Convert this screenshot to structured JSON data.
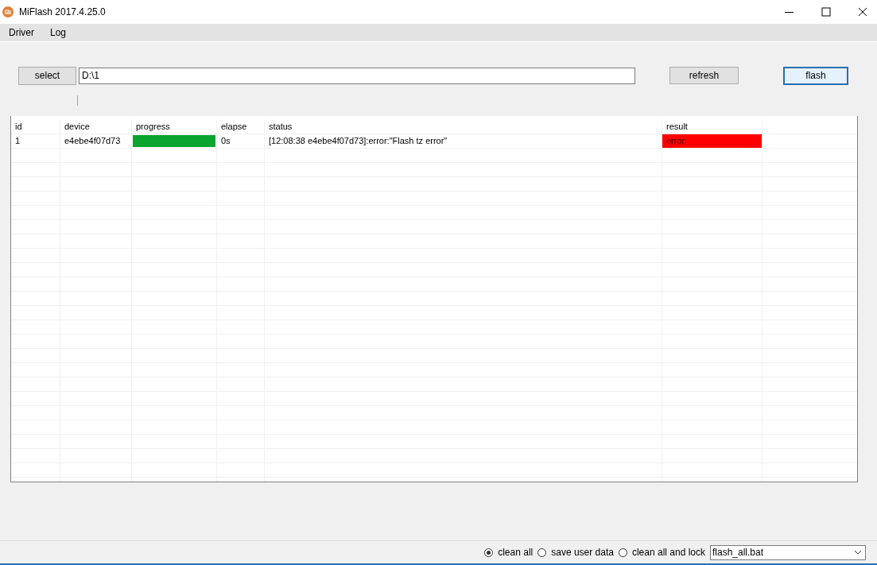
{
  "window": {
    "title": "MiFlash 2017.4.25.0"
  },
  "menu": [
    "Driver",
    "Log"
  ],
  "select_button": "select",
  "path_field": {
    "value": "D:\\1"
  },
  "refresh_button": "refresh",
  "flash_button": {
    "label": "flash",
    "focused": true
  },
  "table": {
    "columns": [
      "id",
      "device",
      "progress",
      "elapse",
      "status",
      "result"
    ],
    "rows": [
      {
        "id": "1",
        "device": "e4ebe4f07d73",
        "progress": {
          "level": 1.0
        },
        "elapse": "0s",
        "status": "[12:08:38  e4ebe4f07d73]:error:\"Flash tz error\"",
        "result": "error",
        "color": "#ff0000"
      }
    ]
  },
  "options": [
    {
      "label": "clean all",
      "selected": true
    },
    {
      "label": "save user data",
      "selected": false
    },
    {
      "label": "clean all and lock",
      "selected": false
    }
  ],
  "script_dropdown": {
    "value": "flash_all.bat"
  }
}
